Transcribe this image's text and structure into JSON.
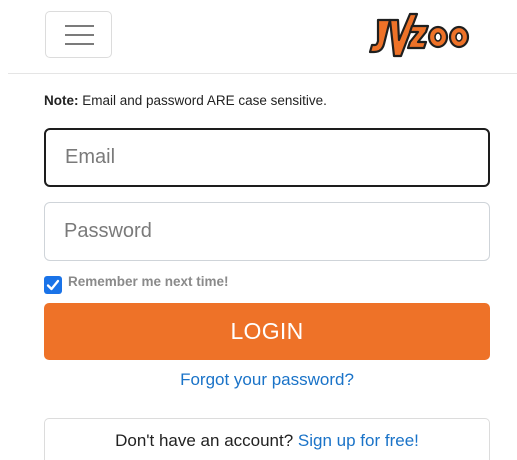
{
  "header": {
    "logo_text": "JVZoo",
    "colors": {
      "logo_orange": "#ee7228",
      "logo_dark": "#1f1f1f"
    }
  },
  "note": {
    "label": "Note:",
    "text": " Email and password ARE case sensitive."
  },
  "form": {
    "email_placeholder": "Email",
    "password_placeholder": "Password",
    "remember_label": "Remember me next time!",
    "remember_checked": true,
    "login_label": "LOGIN",
    "forgot_label": "Forgot your password?"
  },
  "signup": {
    "question": "Don't have an account?",
    "link_label": "Sign up for free!"
  },
  "colors": {
    "accent": "#ee7228",
    "link": "#1a73c8",
    "checkbox": "#1a73e8"
  },
  "icons": {
    "menu": "hamburger-icon",
    "check": "checkmark-icon"
  }
}
